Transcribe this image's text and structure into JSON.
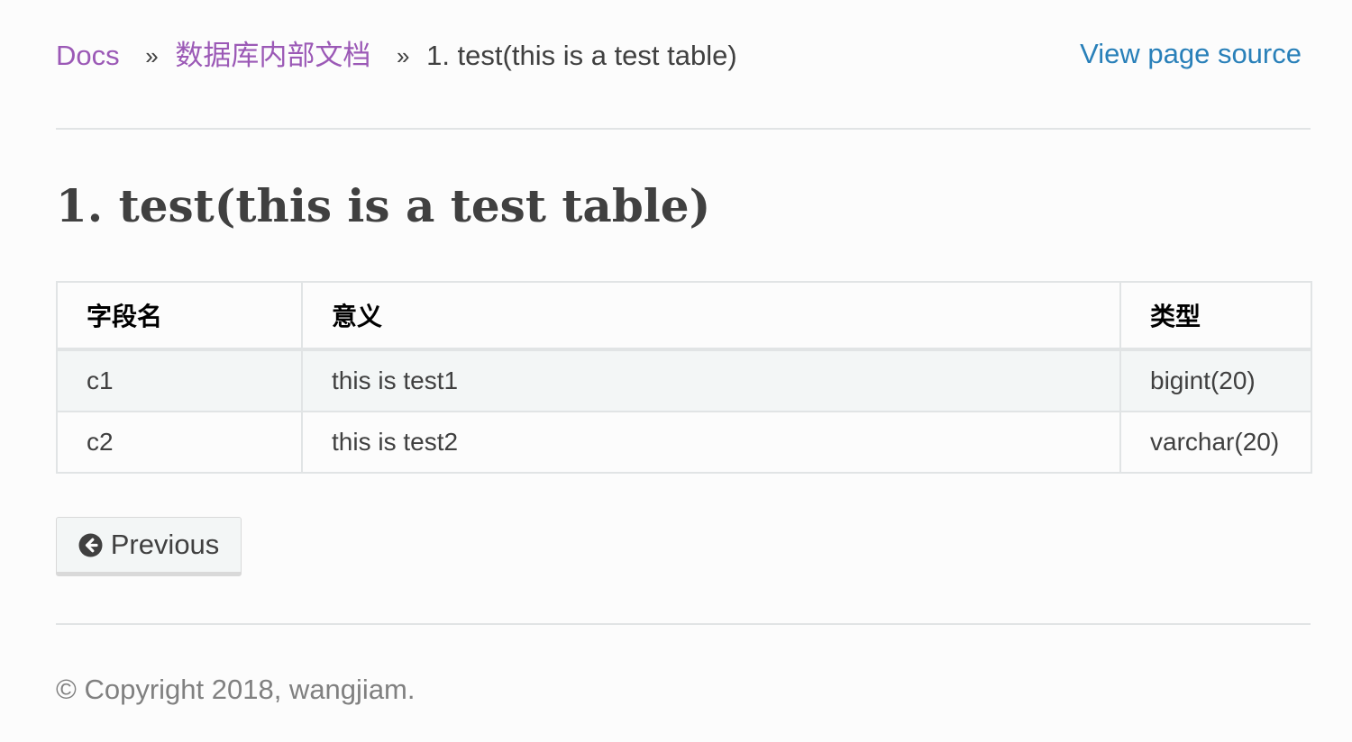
{
  "breadcrumb": {
    "docs": "Docs",
    "separator": "»",
    "section": "数据库内部文档",
    "current": "1. test(this is a test table)"
  },
  "header": {
    "view_source": "View page source"
  },
  "main": {
    "title": "1. test(this is a test table)",
    "table": {
      "columns": [
        "字段名",
        "意义",
        "类型"
      ],
      "rows": [
        [
          "c1",
          "this is test1",
          "bigint(20)"
        ],
        [
          "c2",
          "this is test2",
          "varchar(20)"
        ]
      ]
    }
  },
  "navigation": {
    "previous_label": "Previous",
    "previous_icon": "arrow-circle-left-icon"
  },
  "footer": {
    "copyright": "© Copyright 2018, wangjiam."
  },
  "colors": {
    "link": "#9b59b6",
    "source_link": "#2980b9",
    "text": "#404040",
    "border": "#e1e4e5"
  }
}
